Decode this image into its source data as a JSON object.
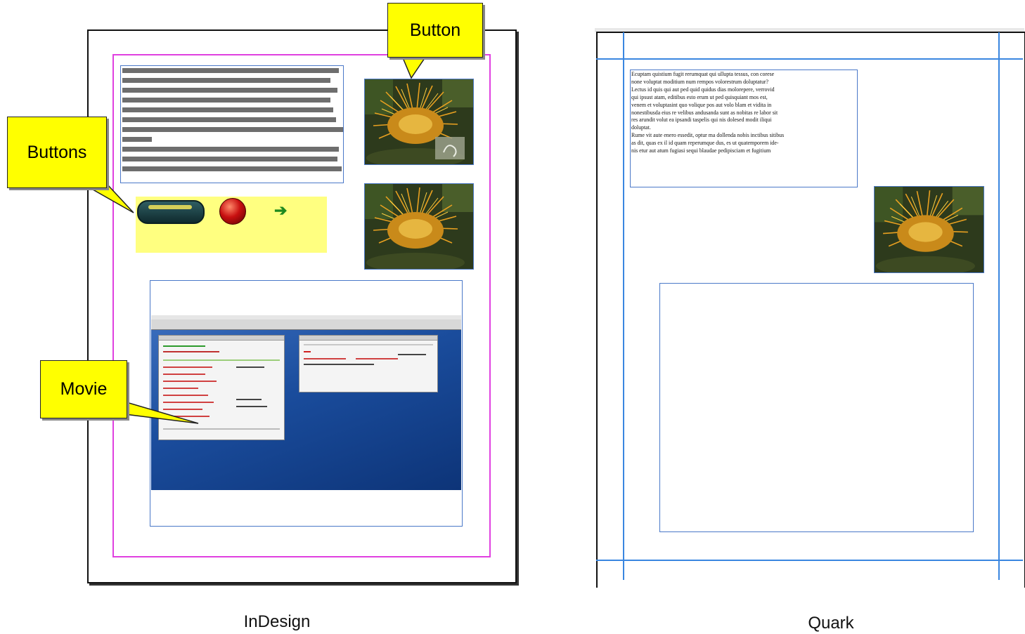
{
  "left_panel": {
    "caption": "InDesign",
    "callouts": {
      "button": "Button",
      "buttons": "Buttons",
      "movie": "Movie"
    }
  },
  "right_panel": {
    "caption": "Quark",
    "text_frame_body": "Ecuptam quistium fugit rerumquat qui ullupta tessus, con corese\nnone voluptat moditium num rempos volorestrum doluptatur?\nLectus id quis qui aut ped quid quidus dias molorepere, verrovid\nqui ipsust atam, editibus esto erum ut ped quisquiant mos est,\nvenem et voluptasint quo volique pos aut volo blam et vidita in\nnonestibusda eius re velibus andusanda sunt as nobitas re labor sit\nres arundit volut ea ipsandi taspelis qui nis dolesed modit iliqui\ndoluptat.\nRume vit aute enero essedit, optur ma dollenda nobis inctibus sitibus\nas dit, quas ex il id quam reperumque dus, es ut quatemporem ide-\nnis etur aut atum fugiasi sequi blaudae pedipisciam et fugitium"
  },
  "colors": {
    "callout_fill": "#ffff00",
    "frame_edge": "#4a78c8",
    "margin_guide": "#e040e0",
    "quark_guide": "#3a86e0",
    "button_area_fill": "#ffff80"
  },
  "icons": {
    "pill_button": "rounded-pill-button-icon",
    "red_ball_button": "red-ball-button-icon",
    "arrow_button": "green-arrow-icon"
  }
}
